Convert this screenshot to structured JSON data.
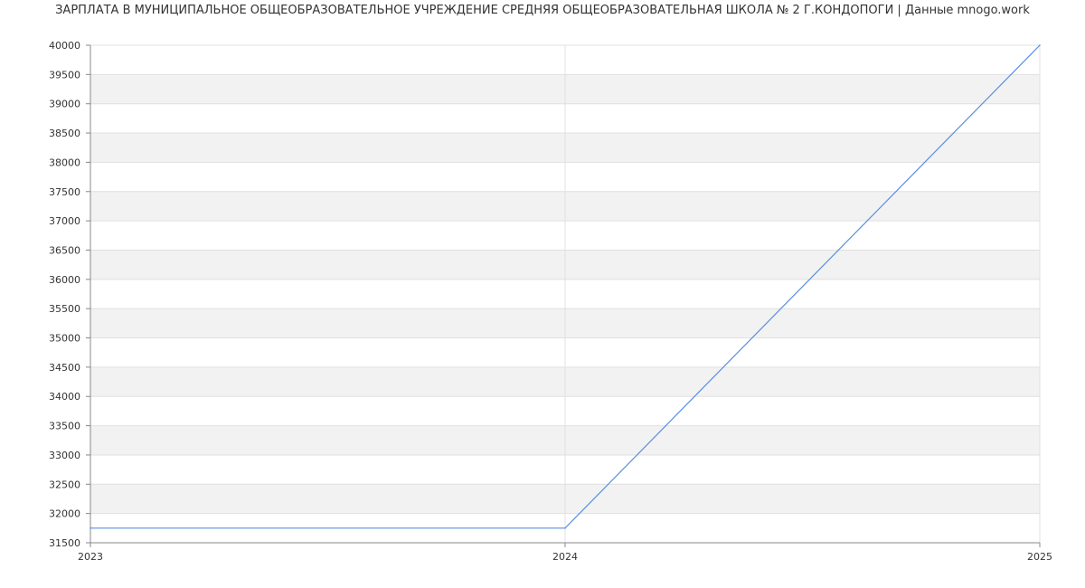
{
  "title": "ЗАРПЛАТА В МУНИЦИПАЛЬНОЕ ОБЩЕОБРАЗОВАТЕЛЬНОЕ УЧРЕЖДЕНИЕ СРЕДНЯЯ ОБЩЕОБРАЗОВАТЕЛЬНАЯ ШКОЛА № 2 Г.КОНДОПОГИ | Данные mnogo.work",
  "colors": {
    "line": "#5b8fe0",
    "band": "#f2f2f2",
    "grid": "#e0e0e0",
    "axis": "#888888"
  },
  "chart_data": {
    "type": "line",
    "title": "ЗАРПЛАТА В МУНИЦИПАЛЬНОЕ ОБЩЕОБРАЗОВАТЕЛЬНОЕ УЧРЕЖДЕНИЕ СРЕДНЯЯ ОБЩЕОБРАЗОВАТЕЛЬНАЯ ШКОЛА № 2 Г.КОНДОПОГИ | Данные mnogo.work",
    "xlabel": "",
    "ylabel": "",
    "x": [
      "2023",
      "2024",
      "2025"
    ],
    "series": [
      {
        "values": [
          31750,
          31750,
          40000
        ]
      }
    ],
    "ylim": [
      31500,
      40000
    ],
    "yticks": [
      31500,
      32000,
      32500,
      33000,
      33500,
      34000,
      34500,
      35000,
      35500,
      36000,
      36500,
      37000,
      37500,
      38000,
      38500,
      39000,
      39500,
      40000
    ],
    "grid": true,
    "alternating_bands": true
  }
}
